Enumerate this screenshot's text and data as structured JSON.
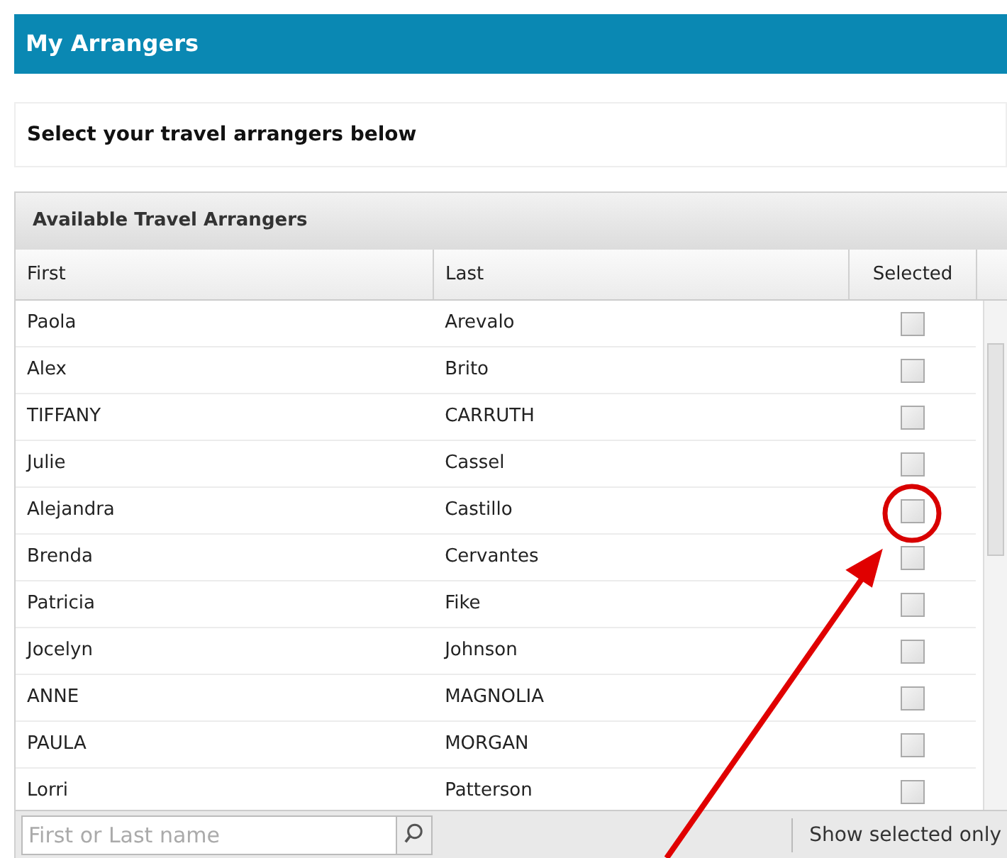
{
  "header": {
    "title": "My Arrangers"
  },
  "instruction": "Select your travel arrangers below",
  "panel": {
    "title": "Available Travel Arrangers",
    "columns": [
      "First",
      "Last",
      "Selected"
    ],
    "rows": [
      {
        "first": "Paola",
        "last": "Arevalo",
        "checked": false
      },
      {
        "first": "Alex",
        "last": "Brito",
        "checked": false
      },
      {
        "first": "TIFFANY",
        "last": "CARRUTH",
        "checked": false
      },
      {
        "first": "Julie",
        "last": "Cassel",
        "checked": false
      },
      {
        "first": "Alejandra",
        "last": "Castillo",
        "checked": false
      },
      {
        "first": "Brenda",
        "last": "Cervantes",
        "checked": false
      },
      {
        "first": "Patricia",
        "last": "Fike",
        "checked": false
      },
      {
        "first": "Jocelyn",
        "last": "Johnson",
        "checked": false
      },
      {
        "first": "ANNE",
        "last": "MAGNOLIA",
        "checked": false
      },
      {
        "first": "PAULA",
        "last": "MORGAN",
        "checked": false
      },
      {
        "first": "Lorri",
        "last": "Patterson",
        "checked": false
      }
    ],
    "search": {
      "placeholder": "First or Last name"
    },
    "filter_button": "Show selected only"
  }
}
